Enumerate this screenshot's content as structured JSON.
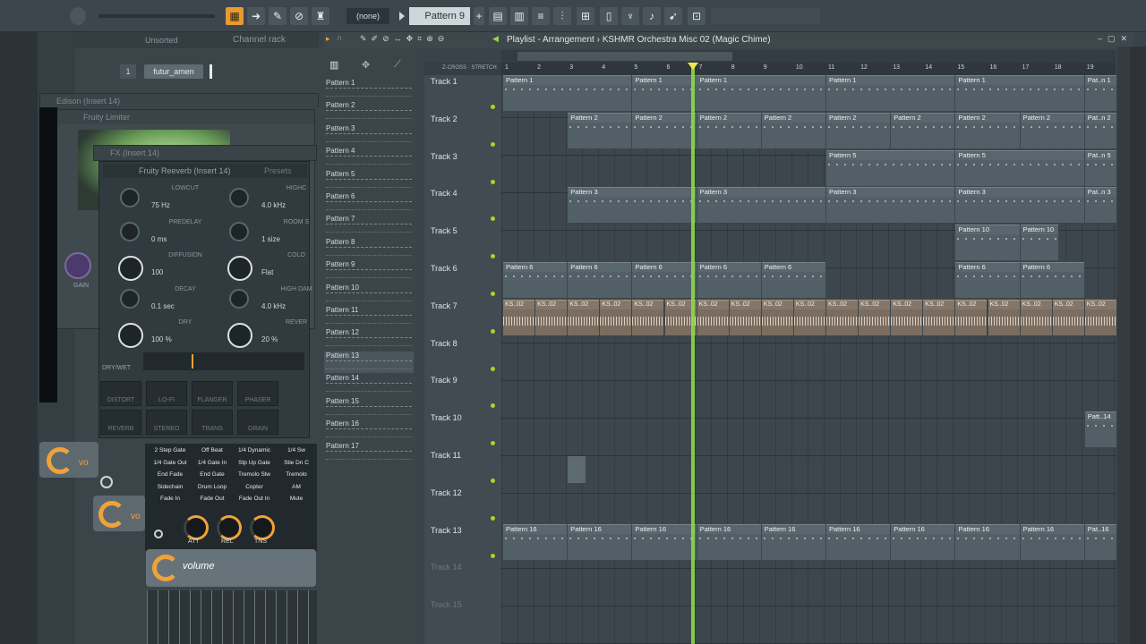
{
  "toolbar": {
    "pattern_none": "(none)",
    "pattern_selected": "Pattern 9"
  },
  "channel_rack": {
    "filter_label": "Unsorted",
    "title": "Channel rack",
    "channel_number": "1",
    "channel_name": "futur_amen"
  },
  "windows": {
    "edison": "Edison (Insert 14)",
    "lemme": "Fruity Limiter",
    "fx": "FX (Insert 14)",
    "reverb": "Fruity Reeverb (Insert 14)",
    "presets": "Presets"
  },
  "reeverb": {
    "knobs": [
      {
        "label": "LOWCUT",
        "value": "75 Hz"
      },
      {
        "label": "HIGHC",
        "value": "4.0 kHz"
      },
      {
        "label": "PREDELAY",
        "value": "0 ms"
      },
      {
        "label": "ROOM S",
        "value": "1 size"
      },
      {
        "label": "DIFFUSION",
        "value": "100"
      },
      {
        "label": "COLO",
        "value": "Flat"
      },
      {
        "label": "DECAY",
        "value": "0.1 sec"
      },
      {
        "label": "HIGH DAM",
        "value": "4.0 kHz"
      },
      {
        "label": "DRY",
        "value": "100 %"
      },
      {
        "label": "REVER",
        "value": "20 %"
      }
    ],
    "dry_wet": "DRY/WET",
    "fx_buttons": [
      "DISTORT",
      "LO-FI",
      "FLANGER",
      "PHASER",
      "REVERB",
      "STEREO",
      "TRANS",
      "GRAIN"
    ]
  },
  "gate_modes": [
    "2 Step Gate",
    "Off Beat",
    "1/4 Dynamic",
    "1/4 Sw",
    "1/4 Gate Out",
    "1/4 Gate In",
    "Stp Up Gate",
    "Stie Dn C",
    "End Fade",
    "End Gate",
    "Tremolo Slw",
    "Tremolo",
    "Sidechain",
    "Drum Loop",
    "Copter",
    "AM",
    "Fade In",
    "Fade Out",
    "Fade Out In",
    "Mute"
  ],
  "env_knobs": [
    "ATT",
    "REL",
    "TNS"
  ],
  "volume_label": "volume",
  "vol_short": "vo",
  "picker_patterns": [
    "Pattern 1",
    "Pattern 2",
    "Pattern 3",
    "Pattern 4",
    "Pattern 5",
    "Pattern 6",
    "Pattern 7",
    "Pattern 8",
    "Pattern 9",
    "Pattern 10",
    "Pattern 11",
    "Pattern 12",
    "Pattern 13",
    "Pattern 14",
    "Pattern 15",
    "Pattern 16",
    "Pattern 17"
  ],
  "playlist": {
    "title": "Playlist - Arrangement",
    "project": "KSHMR Orchestra Misc 02 (Magic Chime)",
    "ruler": [
      "1",
      "2",
      "3",
      "4",
      "5",
      "6",
      "7",
      "8",
      "9",
      "10",
      "11",
      "12",
      "13",
      "14",
      "15",
      "16",
      "17",
      "18",
      "19"
    ],
    "tracks": [
      "Track 1",
      "Track 2",
      "Track 3",
      "Track 4",
      "Track 5",
      "Track 6",
      "Track 7",
      "Track 8",
      "Track 9",
      "Track 10",
      "Track 11",
      "Track 12",
      "Track 13",
      "Track 14",
      "Track 15"
    ],
    "clip_labels": {
      "p1": "Pattern 1",
      "p2": "Pattern 2",
      "p3": "Pattern 3",
      "p5": "Pattern 5",
      "p6": "Pattern 6",
      "p10": "Pattern 10",
      "p16": "Pattern 16",
      "ks": "KS..02",
      "pat_n1": "Pat..n 1",
      "pat_n2": "Pat..n 2",
      "pat_n3": "Pat..n 3",
      "pat_n5": "Pat..n 5",
      "pat_n16": "Pat..16",
      "pat_14": "Patt..14"
    }
  },
  "colors": {
    "accent_orange": "#e79a2f",
    "playhead": "#8ee24a",
    "track_dot": "#a8d52a"
  }
}
